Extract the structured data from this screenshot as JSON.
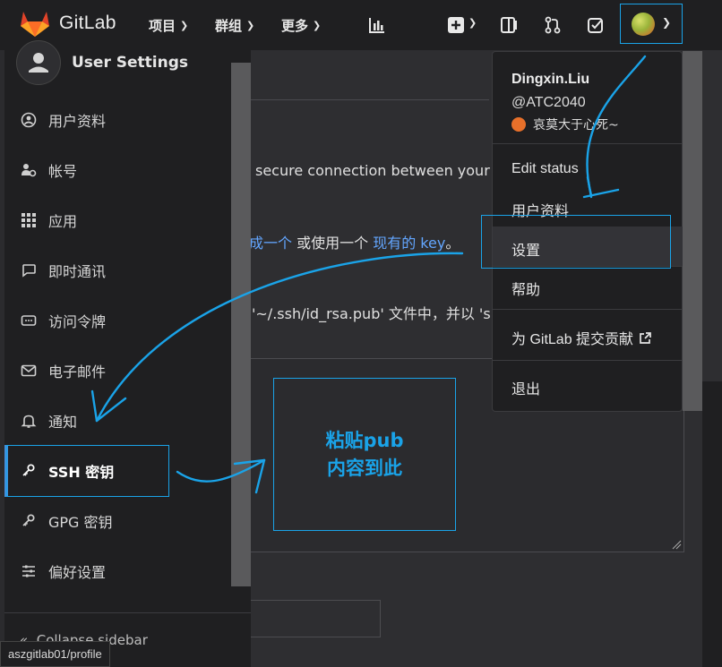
{
  "topbar": {
    "brand": "GitLab",
    "nav": [
      {
        "label": "项目"
      },
      {
        "label": "群组"
      },
      {
        "label": "更多"
      }
    ],
    "icons": [
      "chart-icon",
      "plus-icon",
      "sidebar-icon",
      "merge-request-icon",
      "todo-icon"
    ]
  },
  "sidebar": {
    "title": "User Settings",
    "items": [
      {
        "label": "用户资料",
        "icon": "user-circle-icon"
      },
      {
        "label": "帐号",
        "icon": "account-icon"
      },
      {
        "label": "应用",
        "icon": "apps-icon"
      },
      {
        "label": "即时通讯",
        "icon": "chat-icon"
      },
      {
        "label": "访问令牌",
        "icon": "token-icon"
      },
      {
        "label": "电子邮件",
        "icon": "mail-icon"
      },
      {
        "label": "通知",
        "icon": "bell-icon"
      },
      {
        "label": "SSH 密钥",
        "icon": "key-icon",
        "active": true
      },
      {
        "label": "GPG 密钥",
        "icon": "key-icon"
      },
      {
        "label": "偏好设置",
        "icon": "preferences-icon"
      }
    ],
    "collapse_label": "Collapse sidebar"
  },
  "main": {
    "line1": "secure connection between your c",
    "line2_link1": "成一个",
    "line2_mid": " 或使用一个 ",
    "line2_link2": "现有的 key",
    "line2_end": "。",
    "line3": "'~/.ssh/id_rsa.pub' 文件中，并以 's"
  },
  "dropdown": {
    "name": "Dingxin.Liu",
    "handle": "@ATC2040",
    "status": "哀莫大于心死~",
    "items": [
      {
        "label": "Edit status"
      },
      {
        "label": "用户资料"
      },
      {
        "label": "设置"
      },
      {
        "label": "帮助"
      },
      {
        "label": "为 GitLab 提交贡献"
      },
      {
        "label": "退出"
      }
    ]
  },
  "annotation": {
    "line1": "粘贴pub",
    "line2": "内容到此",
    "color": "#1aa3e8"
  },
  "status_url": "aszgitlab01/profile"
}
